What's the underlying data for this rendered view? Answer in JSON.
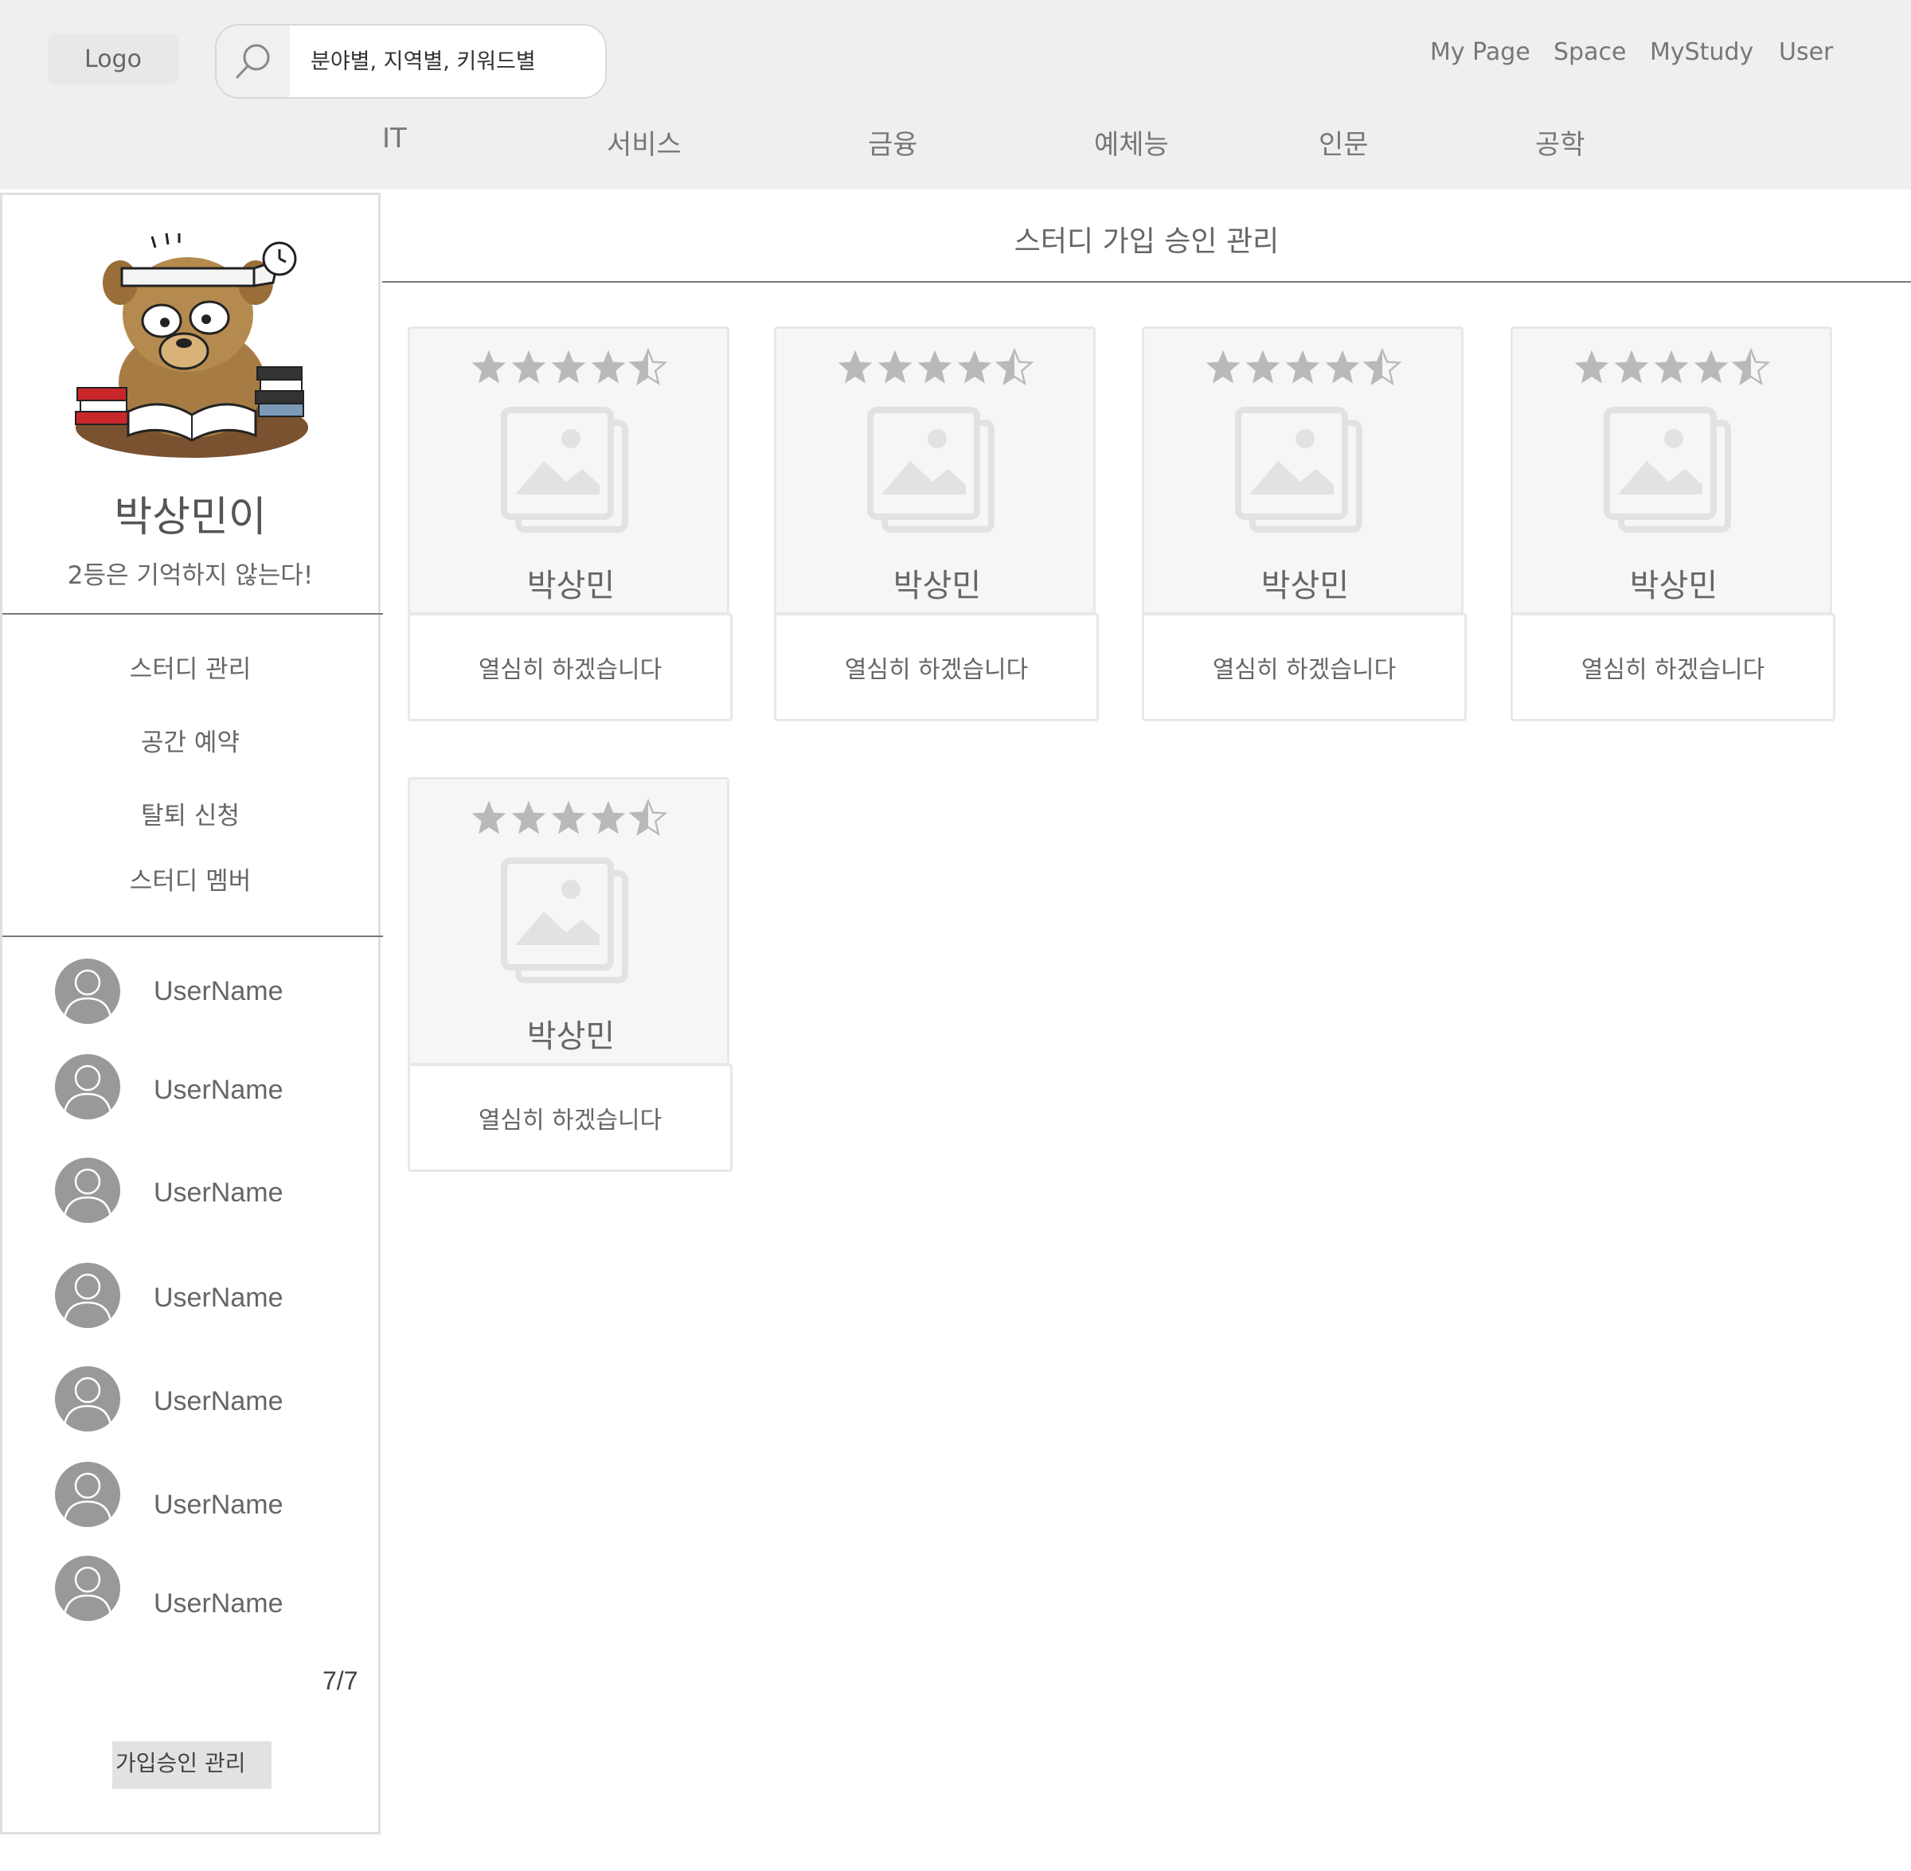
{
  "header": {
    "logo": "Logo",
    "search_placeholder": "분야별, 지역별, 키워드별",
    "top_nav": [
      "My Page",
      "Space",
      "MyStudy",
      "User"
    ],
    "categories": [
      "IT",
      "서비스",
      "금융",
      "예체능",
      "인문",
      "공학"
    ]
  },
  "sidebar": {
    "profile_name": "박상민이",
    "motto": "2등은 기억하지 않는다!",
    "menu": [
      "스터디 관리",
      "공간 예약",
      "탈퇴 신청",
      "스터디 멤버"
    ],
    "members": [
      "UserName",
      "UserName",
      "UserName",
      "UserName",
      "UserName",
      "UserName",
      "UserName"
    ],
    "page_count": "7/7",
    "approve_button": "가입승인 관리"
  },
  "main": {
    "title": "스터디 가입 승인 관리",
    "cards": [
      {
        "name": "박상민",
        "message": "열심히 하겠습니다",
        "rating": 4.5
      },
      {
        "name": "박상민",
        "message": "열심히 하겠습니다",
        "rating": 4.5
      },
      {
        "name": "박상민",
        "message": "열심히 하겠습니다",
        "rating": 4.5
      },
      {
        "name": "박상민",
        "message": "열심히 하겠습니다",
        "rating": 4.5
      },
      {
        "name": "박상민",
        "message": "열심히 하겠습니다",
        "rating": 4.5
      }
    ]
  },
  "colors": {
    "header_bg": "#efefef",
    "star": "#b9b9b9",
    "avatar": "#999999"
  }
}
